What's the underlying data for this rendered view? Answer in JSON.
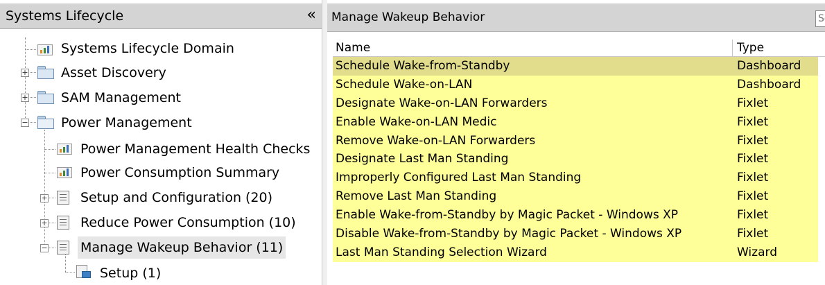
{
  "left_panel": {
    "title": "Systems Lifecycle",
    "collapse_glyph": "«",
    "tree": [
      {
        "label": "Systems Lifecycle Domain",
        "icon": "chart-icon"
      },
      {
        "label": "Asset Discovery",
        "icon": "folder-icon",
        "expander": "+"
      },
      {
        "label": "SAM Management",
        "icon": "folder-icon",
        "expander": "+"
      },
      {
        "label": "Power Management",
        "icon": "folder-open-icon",
        "expander": "−"
      },
      {
        "label": "Power Management Health Checks",
        "icon": "chart-icon"
      },
      {
        "label": "Power Consumption Summary",
        "icon": "chart-icon"
      },
      {
        "label": "Setup and Configuration (20)",
        "icon": "list-icon",
        "expander": "+"
      },
      {
        "label": "Reduce Power Consumption (10)",
        "icon": "list-icon",
        "expander": "+"
      },
      {
        "label": "Manage Wakeup Behavior (11)",
        "icon": "list-icon",
        "expander": "−",
        "selected": true
      },
      {
        "label": "Setup (1)",
        "icon": "document-icon"
      }
    ]
  },
  "right_panel": {
    "title": "Manage Wakeup Behavior",
    "search_placeholder": "Se",
    "columns": {
      "name": "Name",
      "type": "Type"
    },
    "rows": [
      {
        "name": "Schedule Wake-from-Standby",
        "type": "Dashboard",
        "selected": true
      },
      {
        "name": "Schedule Wake-on-LAN",
        "type": "Dashboard"
      },
      {
        "name": "Designate Wake-on-LAN Forwarders",
        "type": "Fixlet"
      },
      {
        "name": "Enable Wake-on-LAN Medic",
        "type": "Fixlet"
      },
      {
        "name": "Remove Wake-on-LAN Forwarders",
        "type": "Fixlet"
      },
      {
        "name": "Designate Last Man Standing",
        "type": "Fixlet"
      },
      {
        "name": "Improperly Configured Last Man Standing",
        "type": "Fixlet"
      },
      {
        "name": "Remove Last Man Standing",
        "type": "Fixlet"
      },
      {
        "name": "Enable Wake-from-Standby by Magic Packet - Windows XP",
        "type": "Fixlet"
      },
      {
        "name": "Disable Wake-from-Standby by Magic Packet - Windows XP",
        "type": "Fixlet"
      },
      {
        "name": "Last Man Standing Selection Wizard",
        "type": "Wizard"
      }
    ]
  },
  "colors": {
    "header_bg": "#d4d4d4",
    "row_highlight": "#ffff99",
    "row_selected": "#e2dd8c",
    "tree_selected": "#e6e6e6"
  }
}
